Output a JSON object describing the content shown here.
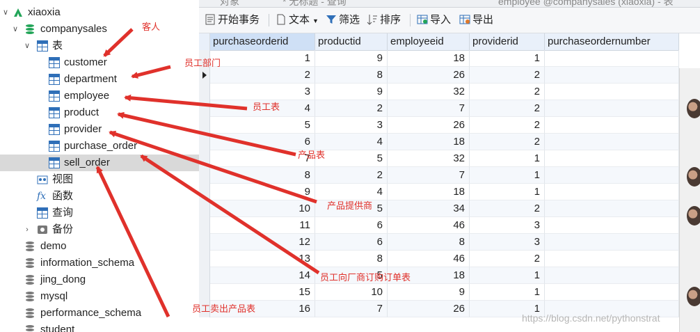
{
  "tabs": [
    "对象",
    "* 无标题 - 查询",
    "employee @companysales (xiaoxia) - 表"
  ],
  "sidebar": {
    "connection": "xiaoxia",
    "database": "companysales",
    "tables_group": "表",
    "tables": [
      "customer",
      "department",
      "employee",
      "product",
      "provider",
      "purchase_order",
      "sell_order"
    ],
    "selected_table": "sell_order",
    "views": "视图",
    "functions": "函数",
    "queries": "查询",
    "backups": "备份",
    "databases": [
      "demo",
      "information_schema",
      "jing_dong",
      "mysql",
      "performance_schema",
      "student"
    ]
  },
  "toolbar": {
    "begin_transaction": "开始事务",
    "text": "文本",
    "filter": "筛选",
    "sort": "排序",
    "import": "导入",
    "export": "导出"
  },
  "grid": {
    "columns": [
      "purchaseorderid",
      "productid",
      "employeeid",
      "providerid",
      "purchaseordernumber"
    ],
    "rows": [
      [
        "1",
        "9",
        "18",
        "1"
      ],
      [
        "2",
        "8",
        "26",
        "2"
      ],
      [
        "3",
        "9",
        "32",
        "2"
      ],
      [
        "4",
        "2",
        "7",
        "2"
      ],
      [
        "5",
        "3",
        "26",
        "2"
      ],
      [
        "6",
        "4",
        "18",
        "2"
      ],
      [
        "7",
        "5",
        "32",
        "1"
      ],
      [
        "8",
        "2",
        "7",
        "1"
      ],
      [
        "9",
        "4",
        "18",
        "1"
      ],
      [
        "10",
        "5",
        "34",
        "2"
      ],
      [
        "11",
        "6",
        "46",
        "3"
      ],
      [
        "12",
        "6",
        "8",
        "3"
      ],
      [
        "13",
        "8",
        "46",
        "2"
      ],
      [
        "14",
        "5",
        "18",
        "1"
      ],
      [
        "15",
        "10",
        "9",
        "1"
      ],
      [
        "16",
        "7",
        "26",
        "1"
      ]
    ],
    "current_row": 2
  },
  "annotations": {
    "customer": "客人",
    "department": "员工部门",
    "employee": "员工表",
    "product": "产品表",
    "provider": "产品提供商",
    "purchase_order": "员工向厂商订购订单表",
    "sell_order": "员工卖出产品表"
  },
  "annotation_color": "#e0312b",
  "watermark": "https://blog.csdn.net/pythonstrat"
}
